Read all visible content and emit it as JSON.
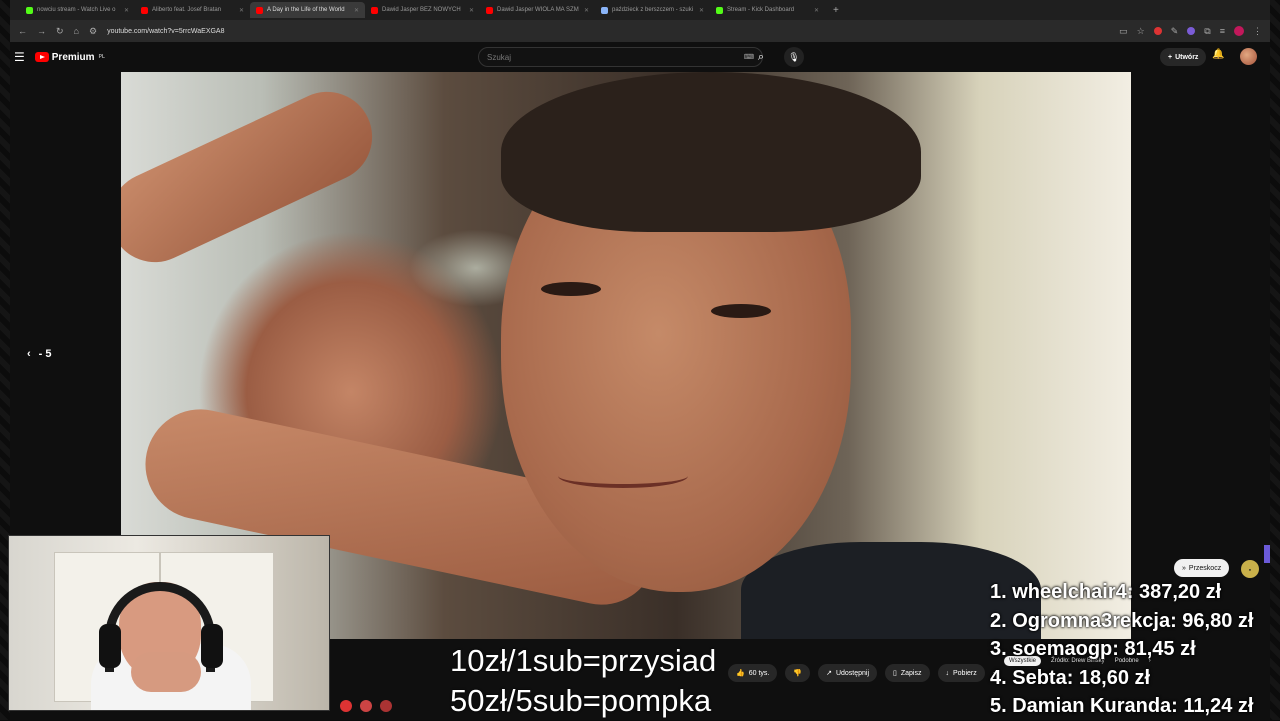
{
  "browser": {
    "tabs": [
      {
        "label": "nowciu stream - Watch Live o",
        "color": "#53fc18",
        "active": false
      },
      {
        "label": "Aliberto feat. Josef Bratan",
        "color": "#ff0000",
        "active": false
      },
      {
        "label": "A Day in the Life of the World",
        "color": "#ff0000",
        "active": true
      },
      {
        "label": "Dawid Jasper BEZ NOWYCH",
        "color": "#ff0000",
        "active": false
      },
      {
        "label": "Dawid Jasper WIOLA MA SZM",
        "color": "#ff0000",
        "active": false
      },
      {
        "label": "paździeck z berszczem - szuki",
        "color": "#8ab4f8",
        "active": false
      },
      {
        "label": "Stream - Kick Dashboard",
        "color": "#53fc18",
        "active": false
      }
    ],
    "url": "youtube.com/watch?v=5rrcWaEXGA8"
  },
  "youtube": {
    "logo_text": "Premium",
    "logo_region": "PL",
    "search_placeholder": "Szukaj",
    "create_label": "Utwórz"
  },
  "player": {
    "seek_back_label": "- 5"
  },
  "overlay": {
    "line1": "10zł/1sub=przysiad",
    "line2": "50zł/5sub=pompka"
  },
  "video_actions": {
    "likes": "60 tys.",
    "share": "Udostępnij",
    "save": "Zapisz",
    "download": "Pobierz"
  },
  "skip_button": "Przeskocz",
  "leaderboard": [
    "1. wheelchair4: 387,20 zł",
    "2. Ogromna3rekcja: 96,80 zł",
    "3. soemaogp: 81,45 zł",
    "4. Sebta: 18,60 zł",
    "5. Damian Kuranda: 11,24 zł"
  ],
  "chips": {
    "all": "Wszystkie",
    "source": "Źródło: Drew Binsky",
    "similar": "Podobne"
  },
  "colors": {
    "yt_red": "#ff0000",
    "bg": "#0f0f0f"
  }
}
